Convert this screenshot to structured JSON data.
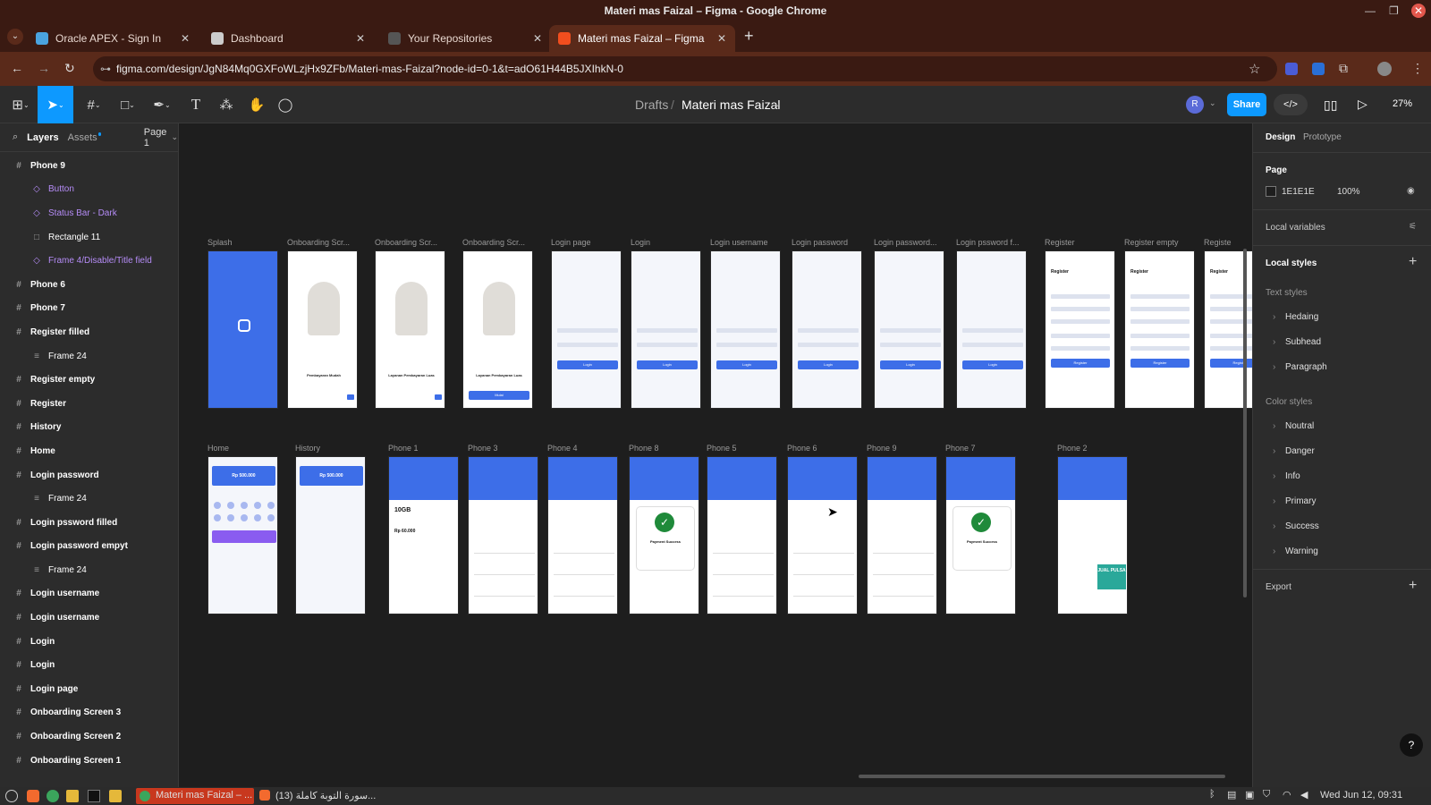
{
  "window": {
    "title": "Materi mas Faizal – Figma - Google Chrome"
  },
  "tabs": [
    {
      "label": "Oracle APEX - Sign In",
      "color": "#4aa3df"
    },
    {
      "label": "Dashboard",
      "color": "#cccccc"
    },
    {
      "label": "Your Repositories",
      "color": "#555555"
    },
    {
      "label": "Materi mas Faizal – Figma",
      "color": "#f24e1e"
    }
  ],
  "url": "figma.com/design/JgN84Mq0GXFoWLzjHx9ZFb/Materi-mas-Faizal?node-id=0-1&t=adO61H44B5JXIhkN-0",
  "figma": {
    "crumb_root": "Drafts",
    "crumb_sep": "/",
    "file_name": "Materi mas Faizal",
    "avatar": "R",
    "share": "Share",
    "zoom": "27%"
  },
  "left_panel": {
    "tab_layers": "Layers",
    "tab_assets": "Assets",
    "page": "Page 1",
    "layers": [
      {
        "label": "Phone 9",
        "kind": "top"
      },
      {
        "label": "Button",
        "kind": "comp"
      },
      {
        "label": "Status Bar - Dark",
        "kind": "comp"
      },
      {
        "label": "Rectangle 11",
        "kind": "rect"
      },
      {
        "label": "Frame 4/Disable/Title field",
        "kind": "comp"
      },
      {
        "label": "Phone 6",
        "kind": "top"
      },
      {
        "label": "Phone 7",
        "kind": "top"
      },
      {
        "label": "Register filled",
        "kind": "top"
      },
      {
        "label": "Frame 24",
        "kind": "child"
      },
      {
        "label": "Register empty",
        "kind": "top"
      },
      {
        "label": "Register",
        "kind": "top"
      },
      {
        "label": "History",
        "kind": "top"
      },
      {
        "label": "Home",
        "kind": "top"
      },
      {
        "label": "Login password",
        "kind": "top"
      },
      {
        "label": "Frame 24",
        "kind": "child"
      },
      {
        "label": "Login pssword filled",
        "kind": "top"
      },
      {
        "label": "Login password empyt",
        "kind": "top"
      },
      {
        "label": "Frame 24",
        "kind": "child"
      },
      {
        "label": "Login username",
        "kind": "top"
      },
      {
        "label": "Login username",
        "kind": "top"
      },
      {
        "label": "Login",
        "kind": "top"
      },
      {
        "label": "Login",
        "kind": "top"
      },
      {
        "label": "Login page",
        "kind": "top"
      },
      {
        "label": "Onboarding Screen 3",
        "kind": "top"
      },
      {
        "label": "Onboarding Screen 2",
        "kind": "top"
      },
      {
        "label": "Onboarding Screen 1",
        "kind": "top"
      }
    ]
  },
  "canvas": {
    "row1": [
      {
        "label": "Splash",
        "type": "splash"
      },
      {
        "label": "Onboarding Scr...",
        "type": "onboard",
        "caption": "Pembayaran Mudah"
      },
      {
        "label": "Onboarding Scr...",
        "type": "onboard",
        "caption": "Layanan Pembayaran Luas"
      },
      {
        "label": "Onboarding Scr...",
        "type": "onboard",
        "caption": "Layanan Pembayaran Luas",
        "btn": "Mulai"
      },
      {
        "label": "Login page",
        "type": "login",
        "btn": "Login"
      },
      {
        "label": "Login",
        "type": "login",
        "btn": "Login"
      },
      {
        "label": "Login username",
        "type": "login",
        "btn": "Login"
      },
      {
        "label": "Login password",
        "type": "login",
        "btn": "Login"
      },
      {
        "label": "Login password...",
        "type": "login",
        "btn": "Login"
      },
      {
        "label": "Login pssword f...",
        "type": "login",
        "btn": "Login"
      },
      {
        "label": "Register",
        "type": "register",
        "title": "Register",
        "btn": "Register"
      },
      {
        "label": "Register empty",
        "type": "register",
        "title": "Register",
        "btn": "Register"
      },
      {
        "label": "Registe",
        "type": "register",
        "title": "Register",
        "btn": "Register"
      }
    ],
    "row2": [
      {
        "label": "Home",
        "type": "home",
        "balance": "Rp 500.000"
      },
      {
        "label": "History",
        "type": "history",
        "balance": "Rp 500.000"
      },
      {
        "label": "Phone 1",
        "type": "phone",
        "big": "10GB",
        "price": "Rp 60.000"
      },
      {
        "label": "Phone 3",
        "type": "phone"
      },
      {
        "label": "Phone 4",
        "type": "phone"
      },
      {
        "label": "Phone 8",
        "type": "phone",
        "success": "Payment Success"
      },
      {
        "label": "Phone 5",
        "type": "phone"
      },
      {
        "label": "Phone 6",
        "type": "phone"
      },
      {
        "label": "Phone 9",
        "type": "phone"
      },
      {
        "label": "Phone 7",
        "type": "phone",
        "success": "Payment Success"
      },
      {
        "label": "Phone 2",
        "type": "phone",
        "promo": "JUAL PULSA"
      }
    ]
  },
  "right_panel": {
    "tab_design": "Design",
    "tab_prototype": "Prototype",
    "page": "Page",
    "page_color": "1E1E1E",
    "page_opacity": "100%",
    "local_variables": "Local variables",
    "local_styles": "Local styles",
    "text_styles": "Text styles",
    "text_items": [
      "Hedaing",
      "Subhead",
      "Paragraph"
    ],
    "color_styles": "Color styles",
    "color_items": [
      "Noutral",
      "Danger",
      "Info",
      "Primary",
      "Success",
      "Warning"
    ],
    "export": "Export"
  },
  "taskbar": {
    "app": "Materi mas Faizal – ...",
    "other": "سورة التوبة كاملة (13)...",
    "clock": "Wed Jun 12, 09:31"
  },
  "colors": {
    "accent": "#0d99ff",
    "figma_blue": "#3d6ee8",
    "chrome_frame": "#3a1a12"
  }
}
